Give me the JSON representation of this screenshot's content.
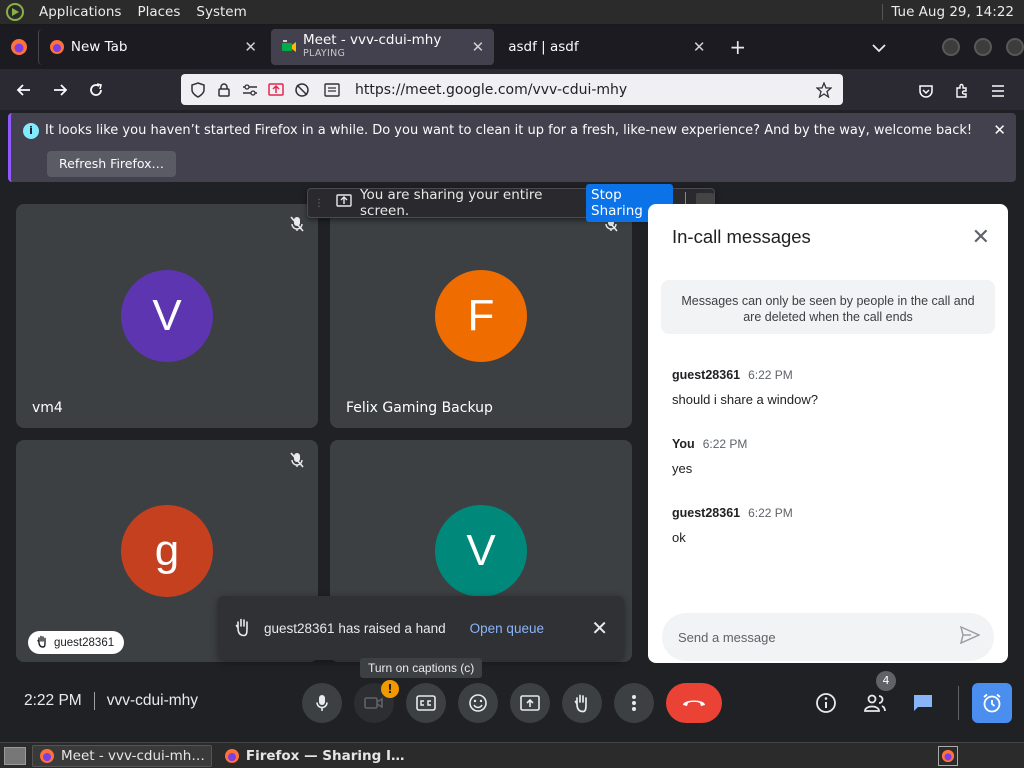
{
  "gnome_panel": {
    "menus": [
      "Applications",
      "Places",
      "System"
    ],
    "clock": "Tue Aug 29, 14:22"
  },
  "tabs": [
    {
      "title": "New Tab"
    },
    {
      "title": "Meet - vvv-cdui-mhy",
      "subtitle": "PLAYING"
    },
    {
      "title": "asdf | asdf"
    }
  ],
  "urlbar": {
    "url": "https://meet.google.com/vvv-cdui-mhy"
  },
  "notification": {
    "text": "It looks like you haven’t started Firefox in a while. Do you want to clean it up for a fresh, like-new experience? And by the way, welcome back!",
    "button": "Refresh Firefox…"
  },
  "share_bar": {
    "text": "You are sharing your entire screen.",
    "stop_label": "Stop Sharing"
  },
  "participants": [
    {
      "name": "vm4",
      "initial": "V",
      "color": "#5e35b1"
    },
    {
      "name": "Felix Gaming Backup",
      "initial": "F",
      "color": "#ef6c00"
    },
    {
      "name": "guest28361",
      "initial": "g",
      "color": "#c5401f"
    },
    {
      "name": "",
      "initial": "V",
      "color": "#00897b"
    }
  ],
  "toast": {
    "text": "guest28361 has raised a hand",
    "action": "Open queue"
  },
  "tooltip": "Turn on captions (c)",
  "chat": {
    "title": "In-call messages",
    "info": "Messages can only be seen by people in the call and are deleted when the call ends",
    "messages": [
      {
        "sender": "guest28361",
        "time": "6:22 PM",
        "text": "should i share a window?"
      },
      {
        "sender": "You",
        "time": "6:22 PM",
        "text": "yes"
      },
      {
        "sender": "guest28361",
        "time": "6:22 PM",
        "text": "ok"
      }
    ],
    "input_placeholder": "Send a message"
  },
  "bottom": {
    "time": "2:22 PM",
    "meeting_code": "vvv-cdui-mhy",
    "participant_count": "4"
  },
  "taskbar": {
    "items": [
      "Meet - vvv-cdui-mh…",
      "Firefox — Sharing I…"
    ]
  },
  "colors": {
    "meet_bg": "#202124",
    "tile_bg": "#3c4043",
    "hangup": "#ea4335",
    "accent_blue": "#8ab4f8",
    "stop_sharing": "#0b72e7"
  }
}
